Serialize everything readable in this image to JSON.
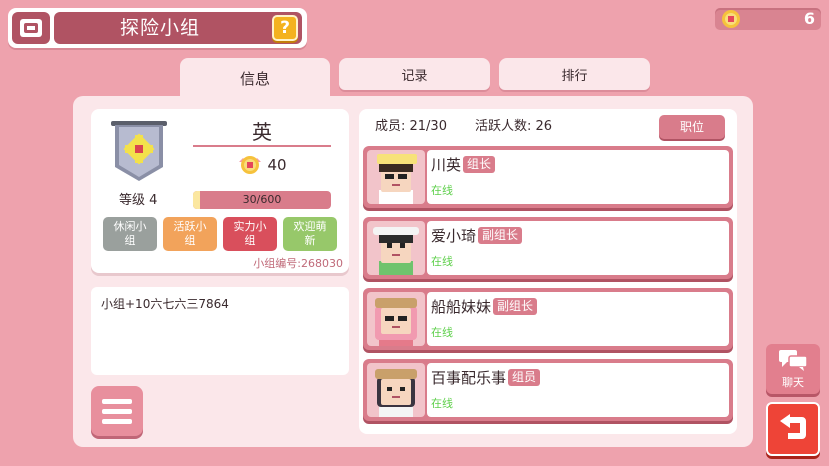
{
  "header": {
    "title": "探险小组",
    "help_label": "?",
    "coins": "6"
  },
  "tabs": [
    {
      "label": "信息",
      "active": true
    },
    {
      "label": "记录",
      "active": false
    },
    {
      "label": "排行",
      "active": false
    }
  ],
  "group": {
    "name": "英",
    "score": "40",
    "level_label": "等级 4",
    "exp": "30/600",
    "exp_fraction": 0.05,
    "tags": [
      {
        "label": "休闲小组",
        "color": "#9aa09d"
      },
      {
        "label": "活跃小组",
        "color": "#f2a35b"
      },
      {
        "label": "实力小组",
        "color": "#d94f5c"
      },
      {
        "label": "欢迎萌新",
        "color": "#97c86a"
      }
    ],
    "group_id": "小组编号:268030",
    "description": "小组+10六七六三7864"
  },
  "members_header": {
    "members": "成员: 21/30",
    "active": "活跃人数: 26",
    "position_button": "职位"
  },
  "members": [
    {
      "name": "川英",
      "role": "组长",
      "status": "在线",
      "hat": "#f7e27a",
      "hair": "#3a2b22"
    },
    {
      "name": "爱小琦",
      "role": "副组长",
      "status": "在线",
      "hat": "#f4f4f4",
      "hair": "#2b2b2b"
    },
    {
      "name": "船船妹妹",
      "role": "副组长",
      "status": "在线",
      "hat": "#c9a06a",
      "hair": "#f19ab0"
    },
    {
      "name": "百事配乐事",
      "role": "组员",
      "status": "在线",
      "hat": "#c9a06a",
      "hair": "#3b3440"
    }
  ],
  "side": {
    "chat_label": "聊天"
  },
  "colors": {
    "background": "#eea2ad",
    "panel": "#fbe7ea",
    "accent": "#d97c8b",
    "online": "#5fd04c",
    "return": "#ee4437"
  }
}
